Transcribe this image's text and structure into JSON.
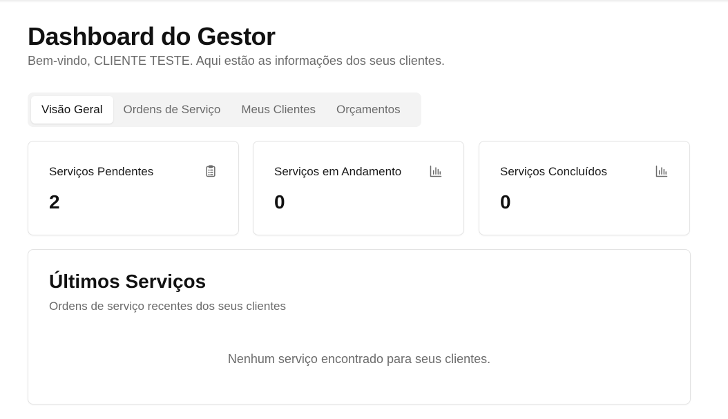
{
  "header": {
    "title": "Dashboard do Gestor",
    "subtitle": "Bem-vindo, CLIENTE TESTE. Aqui estão as informações dos seus clientes."
  },
  "tabs": [
    {
      "label": "Visão Geral",
      "active": true
    },
    {
      "label": "Ordens de Serviço",
      "active": false
    },
    {
      "label": "Meus Clientes",
      "active": false
    },
    {
      "label": "Orçamentos",
      "active": false
    }
  ],
  "stats": [
    {
      "label": "Serviços Pendentes",
      "value": "2",
      "icon": "clipboard-list-icon"
    },
    {
      "label": "Serviços em Andamento",
      "value": "0",
      "icon": "bar-chart-icon"
    },
    {
      "label": "Serviços Concluídos",
      "value": "0",
      "icon": "bar-chart-icon"
    }
  ],
  "recent": {
    "title": "Últimos Serviços",
    "description": "Ordens de serviço recentes dos seus clientes",
    "empty_message": "Nenhum serviço encontrado para seus clientes."
  },
  "colors": {
    "text": "#111111",
    "muted": "#6b6b6b",
    "border": "#e3e3e3",
    "tabs_bg": "#f3f3f3"
  }
}
